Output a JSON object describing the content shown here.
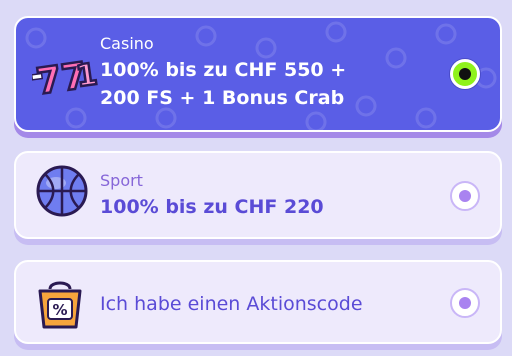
{
  "options": [
    {
      "label": "Casino",
      "title_line1": "100% bis zu CHF 550 +",
      "title_line2": "200 FS + 1 Bonus Crab",
      "selected": true,
      "icon": "slot-777-icon"
    },
    {
      "label": "Sport",
      "title": "100% bis zu CHF 220",
      "selected": false,
      "icon": "basketball-icon"
    },
    {
      "label": "",
      "title": "Ich habe einen Aktionscode",
      "selected": false,
      "icon": "percent-bag-icon"
    }
  ],
  "colors": {
    "background": "#dcdaf7",
    "selected_card": "#5a5ee6",
    "unselected_card": "#eeeafc",
    "radio_selected": "#8ff21a",
    "radio_unselected_dot": "#a983f0",
    "title_text": "#5a4bd6"
  }
}
